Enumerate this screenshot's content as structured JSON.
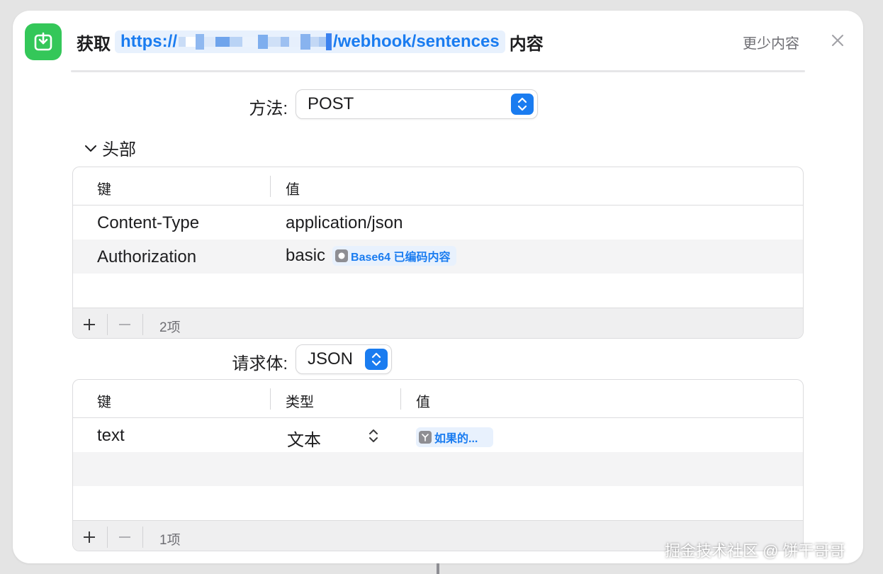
{
  "header": {
    "action": "获取",
    "url_prefix": "https://",
    "url_suffix": "/webhook/sentences",
    "content_word": "内容",
    "less_label": "更少内容"
  },
  "method": {
    "label": "方法:",
    "value": "POST"
  },
  "headers_section": {
    "title": "头部",
    "col_key": "键",
    "col_value": "值",
    "rows": [
      {
        "key": "Content-Type",
        "value": "application/json"
      },
      {
        "key": "Authorization",
        "value": "basic",
        "token": "Base64 已编码内容"
      }
    ],
    "count": "2项"
  },
  "body": {
    "label": "请求体:",
    "value": "JSON",
    "col_key": "键",
    "col_type": "类型",
    "col_value": "值",
    "rows": [
      {
        "key": "text",
        "type": "文本",
        "token": "如果的..."
      }
    ],
    "count": "1项"
  },
  "watermark": "掘金技术社区 @ 饼干哥哥",
  "colors": {
    "accent": "#1a7cf0",
    "app_icon": "#34c759",
    "token_bg": "#e8f1fd"
  }
}
